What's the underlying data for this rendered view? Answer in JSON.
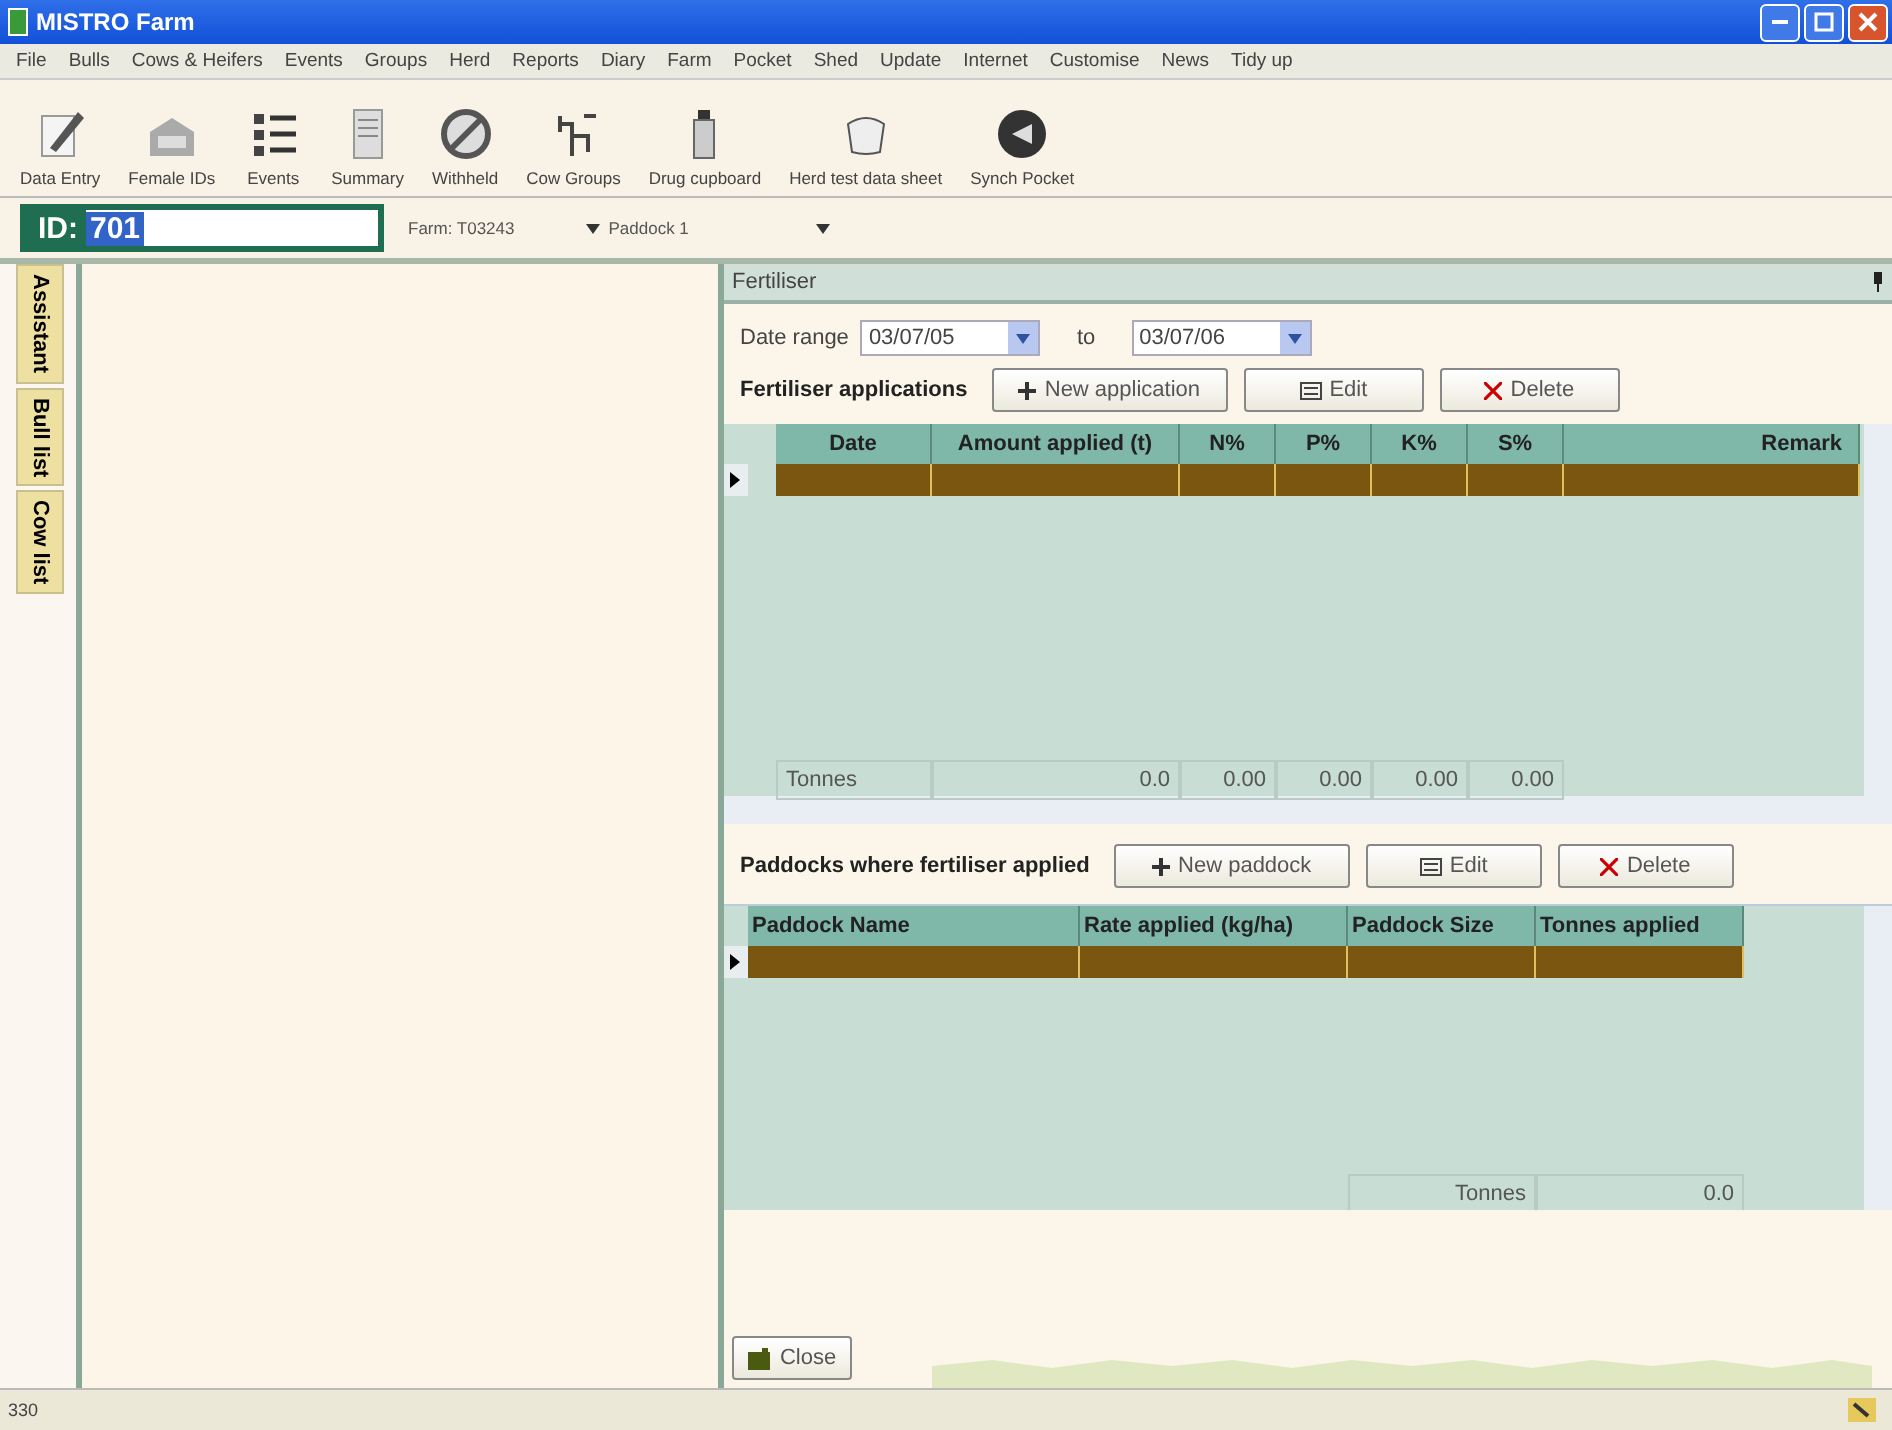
{
  "window": {
    "title": "MISTRO Farm"
  },
  "menu": [
    "File",
    "Bulls",
    "Cows & Heifers",
    "Events",
    "Groups",
    "Herd",
    "Reports",
    "Diary",
    "Farm",
    "Pocket",
    "Shed",
    "Update",
    "Internet",
    "Customise",
    "News",
    "Tidy up"
  ],
  "toolbar": [
    {
      "label": "Data Entry",
      "kind": "pencil"
    },
    {
      "label": "Female IDs",
      "kind": "barn"
    },
    {
      "label": "Events",
      "kind": "list"
    },
    {
      "label": "Summary",
      "kind": "sheet"
    },
    {
      "label": "Withheld",
      "kind": "ban"
    },
    {
      "label": "Cow Groups",
      "kind": "tree"
    },
    {
      "label": "Drug cupboard",
      "kind": "bottle"
    },
    {
      "label": "Herd test data sheet",
      "kind": "cup"
    },
    {
      "label": "Synch Pocket",
      "kind": "sync"
    }
  ],
  "id_bar": {
    "label": "ID:",
    "value": "701",
    "farm": "Farm: T03243",
    "paddock": "Paddock 1"
  },
  "side_tabs": [
    "Assistant",
    "Bull list",
    "Cow list"
  ],
  "panel": {
    "title": "Fertiliser",
    "date_label": "Date range",
    "date_from": "03/07/05",
    "to_label": "to",
    "date_to": "03/07/06",
    "applications": {
      "title": "Fertiliser applications",
      "buttons": [
        {
          "label": "New application",
          "kind": "add"
        },
        {
          "label": "Edit",
          "kind": "edit"
        },
        {
          "label": "Delete",
          "kind": "delete"
        }
      ],
      "columns": [
        "Date",
        "Amount applied (t)",
        "N%",
        "P%",
        "K%",
        "S%",
        "Remark"
      ],
      "rows": [
        {
          "selected": true
        }
      ],
      "totals": [
        "Tonnes",
        "0.0",
        "0.00",
        "0.00",
        "0.00",
        "0.00"
      ]
    },
    "paddocks": {
      "title": "Paddocks where fertiliser applied",
      "buttons": [
        {
          "label": "New paddock",
          "kind": "add"
        },
        {
          "label": "Edit",
          "kind": "edit"
        },
        {
          "label": "Delete",
          "kind": "delete"
        }
      ],
      "columns": [
        "Paddock Name",
        "Rate applied (kg/ha)",
        "Paddock Size",
        "Tonnes applied"
      ],
      "rows": [
        {
          "selected": true
        }
      ],
      "totals": [
        "Tonnes",
        "0.0"
      ]
    },
    "close": "Close"
  },
  "status_bar": {
    "text": "330"
  }
}
